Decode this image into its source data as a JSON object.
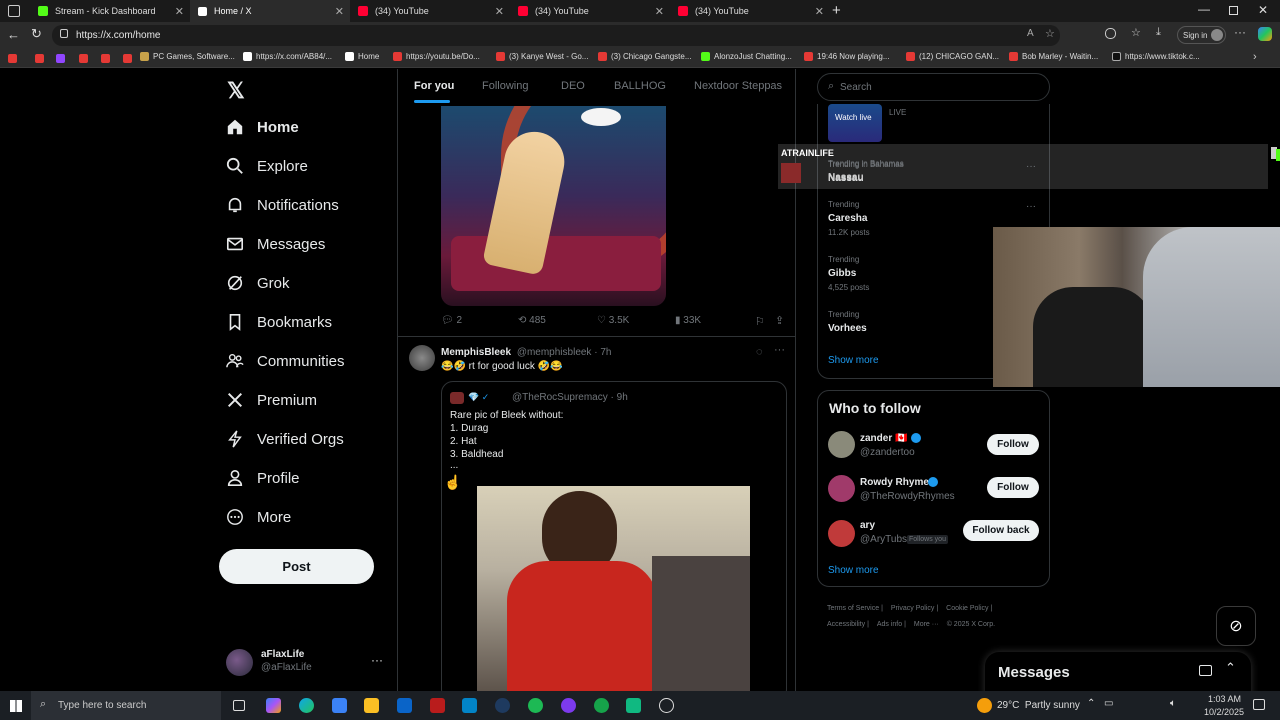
{
  "tabs": [
    {
      "title": "Stream - Kick Dashboard",
      "color": "#53fc18"
    },
    {
      "title": "Home / X",
      "color": "#ffffff"
    },
    {
      "title": "(34) YouTube",
      "color": "#ff0033"
    },
    {
      "title": "(34) YouTube",
      "color": "#ff0033"
    },
    {
      "title": "(34) YouTube",
      "color": "#ff0033"
    }
  ],
  "address": {
    "url": "https://x.com/home",
    "signin": "Sign in"
  },
  "bookmarks": [
    "PC Games, Software...",
    "https://x.com/AB84/...",
    "Home",
    "https://youtu.be/Do...",
    "(3) Kanye West - Go...",
    "(3) Chicago Gangste...",
    "AlonzoJust Chatting...",
    "19:46 Now playing...",
    "(12) CHICAGO GAN...",
    "Bob Marley - Waitin...",
    "https://www.tiktok.c..."
  ],
  "sidebar": {
    "items": [
      "Home",
      "Explore",
      "Notifications",
      "Messages",
      "Grok",
      "Bookmarks",
      "Communities",
      "Premium",
      "Verified Orgs",
      "Profile",
      "More"
    ],
    "post_label": "Post",
    "account_name": "aFlaxLife",
    "account_handle": "@aFlaxLife"
  },
  "feed": {
    "tabs": [
      "For you",
      "Following",
      "DEO",
      "BALLHOG",
      "Nextdoor Steppas"
    ],
    "first_post_stats": {
      "replies": "2",
      "reposts": "485",
      "likes": "3.5K",
      "views": "33K"
    },
    "post": {
      "author": "MemphisBleek",
      "handle": "@memphisbleek · 7h",
      "text": "😂🤣 rt for good luck 🤣😂",
      "quote_handle": "@TheRocSupremacy · 9h",
      "quote_lines": [
        "Rare pic of Bleek without:",
        "1. Durag",
        "2. Hat",
        "3. Baldhead",
        "..."
      ]
    }
  },
  "right": {
    "search_placeholder": "Search",
    "live_label": "LIVE",
    "watch_live": "Watch live",
    "overlay_name": "ATRAINLIFE",
    "trends": [
      {
        "context": "Trending in Bahamas",
        "name": "Nassau",
        "count": ""
      },
      {
        "context": "Trending",
        "name": "Caresha",
        "count": "11.2K posts"
      },
      {
        "context": "Trending",
        "name": "Gibbs",
        "count": "4,525 posts"
      },
      {
        "context": "Trending",
        "name": "Vorhees",
        "count": ""
      }
    ],
    "show_more": "Show more",
    "who_to_follow": "Who to follow",
    "follows": [
      {
        "name": "zander 🇨🇦",
        "handle": "@zandertoo",
        "button": "Follow",
        "badge": ""
      },
      {
        "name": "Rowdy Rhymes",
        "handle": "@TheRowdyRhymes",
        "button": "Follow",
        "badge": ""
      },
      {
        "name": "ary",
        "handle": "@AryTubs",
        "button": "Follow back",
        "badge": "Follows you"
      }
    ],
    "footer": [
      "Terms of Service",
      "Privacy Policy",
      "Cookie Policy",
      "Accessibility",
      "Ads info",
      "More ···",
      "© 2025 X Corp."
    ],
    "messages": "Messages"
  },
  "taskbar": {
    "search": "Type here to search",
    "weather": "29°C  Partly sunny",
    "time": "1:03 AM",
    "date": "10/2/2025"
  }
}
